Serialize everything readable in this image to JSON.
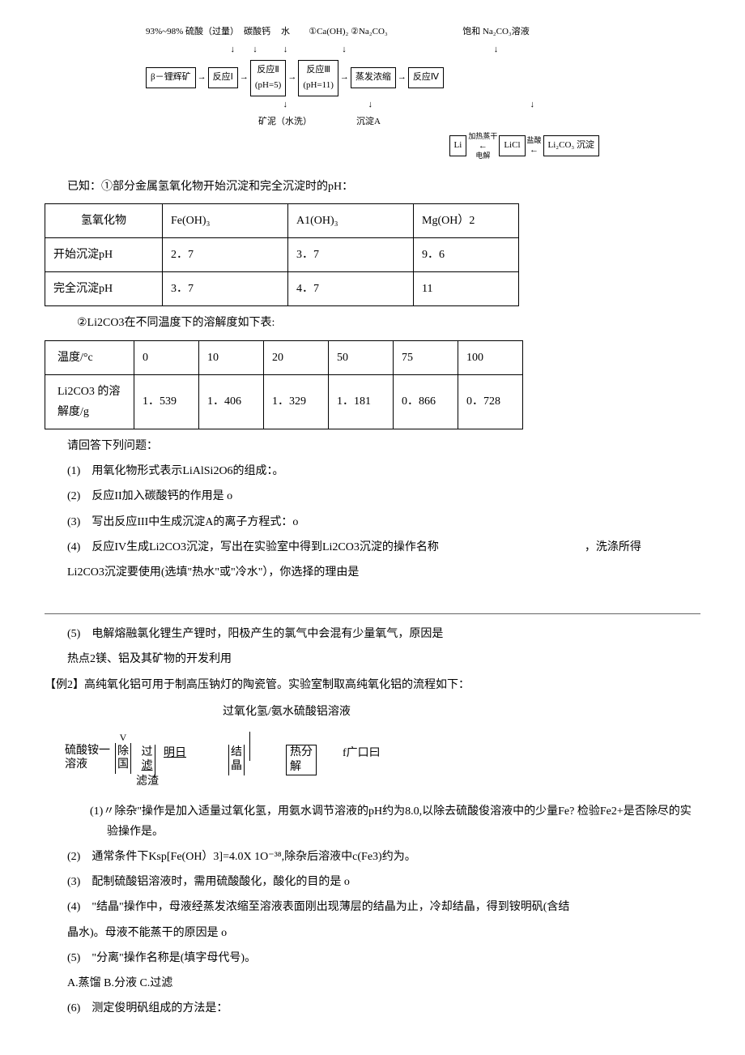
{
  "flowchart": {
    "top_labels": [
      "93%~98% 硫酸（过量）",
      "碳酸钙",
      "水",
      "①Ca(OH)₂ ②Na₂CO₃",
      "饱和 Na₂CO₃溶液"
    ],
    "row1": {
      "b1": "β－锂辉矿",
      "a1": "→",
      "b2": "反应Ⅰ",
      "a2": "→",
      "b3_l1": "反应Ⅱ",
      "b3_l2": "(pH=5)",
      "a3": "→",
      "b4_l1": "反应Ⅲ",
      "b4_l2": "(pH=11)",
      "a4": "→",
      "b5": "蒸发浓缩",
      "a5": "→",
      "b6": "反应Ⅳ"
    },
    "under": {
      "u1": "矿泥（水洗）",
      "u2": "沉淀A",
      "chain": {
        "b1": "Li",
        "a1": "←",
        "lbl1_l1": "加热蒸干",
        "lbl1_l2": "电解",
        "b2": "LiCl",
        "a2": "←",
        "lbl2": "盐酸",
        "b3": "Li₂CO₃ 沉淀"
      }
    }
  },
  "known_intro": "已知：①部分金属氢氧化物开始沉淀和完全沉淀时的pH：",
  "table1": {
    "h": [
      "氢氧化物",
      "Fe(OH)₃",
      "A1(OH)₃",
      "Mg(OH）2"
    ],
    "r1": [
      "开始沉淀pH",
      "2．7",
      "3．7",
      "9．6"
    ],
    "r2": [
      "完全沉淀pH",
      "3．7",
      "4．7",
      "11"
    ]
  },
  "known2": "②Li2CO3在不同温度下的溶解度如下表:",
  "table2": {
    "h": [
      "温度/°c",
      "0",
      "10",
      "20",
      "50",
      "75",
      "100"
    ],
    "r1": [
      "Li2CO3 的溶解度/g",
      "1．539",
      "1．406",
      "1．329",
      "1．181",
      "0．866",
      "0．728"
    ]
  },
  "q_intro": "请回答下列问题：",
  "q1": "(1)　用氧化物形式表示LiAlSi2O6的组成：。",
  "q2": "(2)　反应II加入碳酸钙的作用是  o",
  "q3": "(3)　写出反应III中生成沉淀A的离子方程式：o",
  "q4_a": "(4)　反应IV生成Li2CO3沉淀，写出在实验室中得到Li2CO3沉淀的操作名称",
  "q4_b": "，洗涤所得",
  "q4_c": "Li2CO3沉淀要使用(选填\"热水\"或\"冷水\"），你选择的理由是",
  "q5": "(5)　电解熔融氯化锂生产锂时，阳极产生的氯气中会混有少量氧气，原因是",
  "hot2": "热点2镁、铝及其矿物的开发利用",
  "ex2": "【例2】高纯氧化铝可用于制高压钠灯的陶瓷管。实验室制取高纯氧化铝的流程如下：",
  "d2_label": "过氧化氢/氨水硫酸铝溶液",
  "d2": {
    "left_l1": "硫酸铵一",
    "left_l2": "溶液",
    "v": "V",
    "b1_l1": "除",
    "b1_l2": "国",
    "b2_l1": "过",
    "b2_l2": "滤",
    "slag": "滤渣",
    "b3": "明日",
    "b4_l1": "结",
    "b4_l2": "晶",
    "b5_l1": "热分",
    "b5_l2": "解",
    "out": "f广口曰"
  },
  "e2_q1": "(1)〃除杂\"操作是加入适量过氧化氢，用氨水调节溶液的pH约为8.0,以除去硫酸俊溶液中的少量Fe? 检验Fe2+是否除尽的实验操作是。",
  "e2_q2": "(2)　通常条件下Ksp[Fe(OH）3]=4.0X 1O⁻³⁸,除杂后溶液中c(Fe3)约为。",
  "e2_q3": "(3)　配制硫酸铝溶液时，需用硫酸酸化，酸化的目的是  o",
  "e2_q4_a": "(4)　\"结晶\"操作中，母液经蒸发浓缩至溶液表面刚出现薄层的结晶为止，冷却结晶，得到铵明矾(含结",
  "e2_q4_b": "晶水)。母液不能蒸干的原因是  o",
  "e2_q5": "(5)　\"分离\"操作名称是(填字母代号)。",
  "e2_q5_opts": "A.蒸馏 B.分液 C.过滤",
  "e2_q6": "(6)　测定俊明矾组成的方法是："
}
